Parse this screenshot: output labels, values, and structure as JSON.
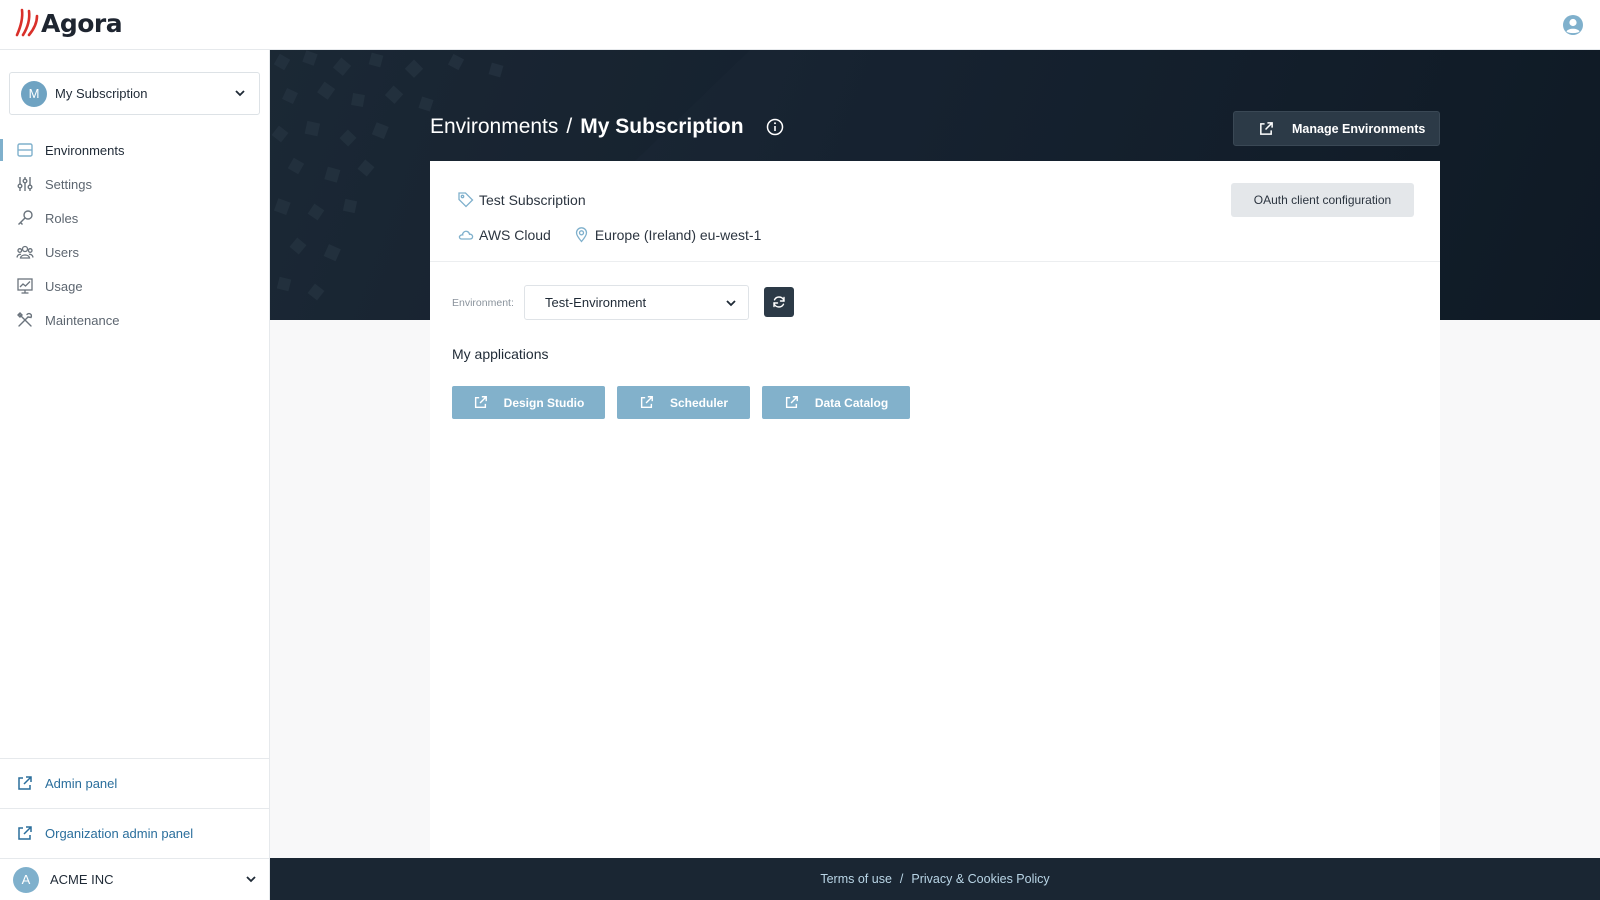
{
  "app": {
    "name": "Agora"
  },
  "sidebar": {
    "subscription": {
      "avatar_letter": "M",
      "label": "My Subscription"
    },
    "items": [
      {
        "label": "Environments",
        "icon": "server-icon",
        "active": true
      },
      {
        "label": "Settings",
        "icon": "sliders-icon"
      },
      {
        "label": "Roles",
        "icon": "key-icon"
      },
      {
        "label": "Users",
        "icon": "users-icon"
      },
      {
        "label": "Usage",
        "icon": "chart-icon"
      },
      {
        "label": "Maintenance",
        "icon": "tools-icon"
      }
    ],
    "admin_panel": "Admin panel",
    "org_admin_panel": "Organization admin panel",
    "org": {
      "avatar_letter": "A",
      "label": "ACME INC"
    }
  },
  "header": {
    "breadcrumb_root": "Environments",
    "separator": "/",
    "current": "My Subscription",
    "manage_button": "Manage Environments"
  },
  "card": {
    "subscription_name": "Test Subscription",
    "cloud": "AWS Cloud",
    "region": "Europe (Ireland) eu-west-1",
    "oauth_button": "OAuth client configuration",
    "environment_label": "Environment:",
    "environment_value": "Test-Environment",
    "apps_title": "My applications",
    "apps": [
      {
        "label": "Design Studio"
      },
      {
        "label": "Scheduler"
      },
      {
        "label": "Data Catalog"
      }
    ]
  },
  "footer": {
    "terms": "Terms of use",
    "separator": "/",
    "privacy": "Privacy & Cookies Policy"
  },
  "colors": {
    "accent": "#7fb0cc",
    "app_button": "#82b1cb",
    "hero_dark": "#162230",
    "link": "#2a6e9c",
    "logo_red": "#d9302a"
  }
}
